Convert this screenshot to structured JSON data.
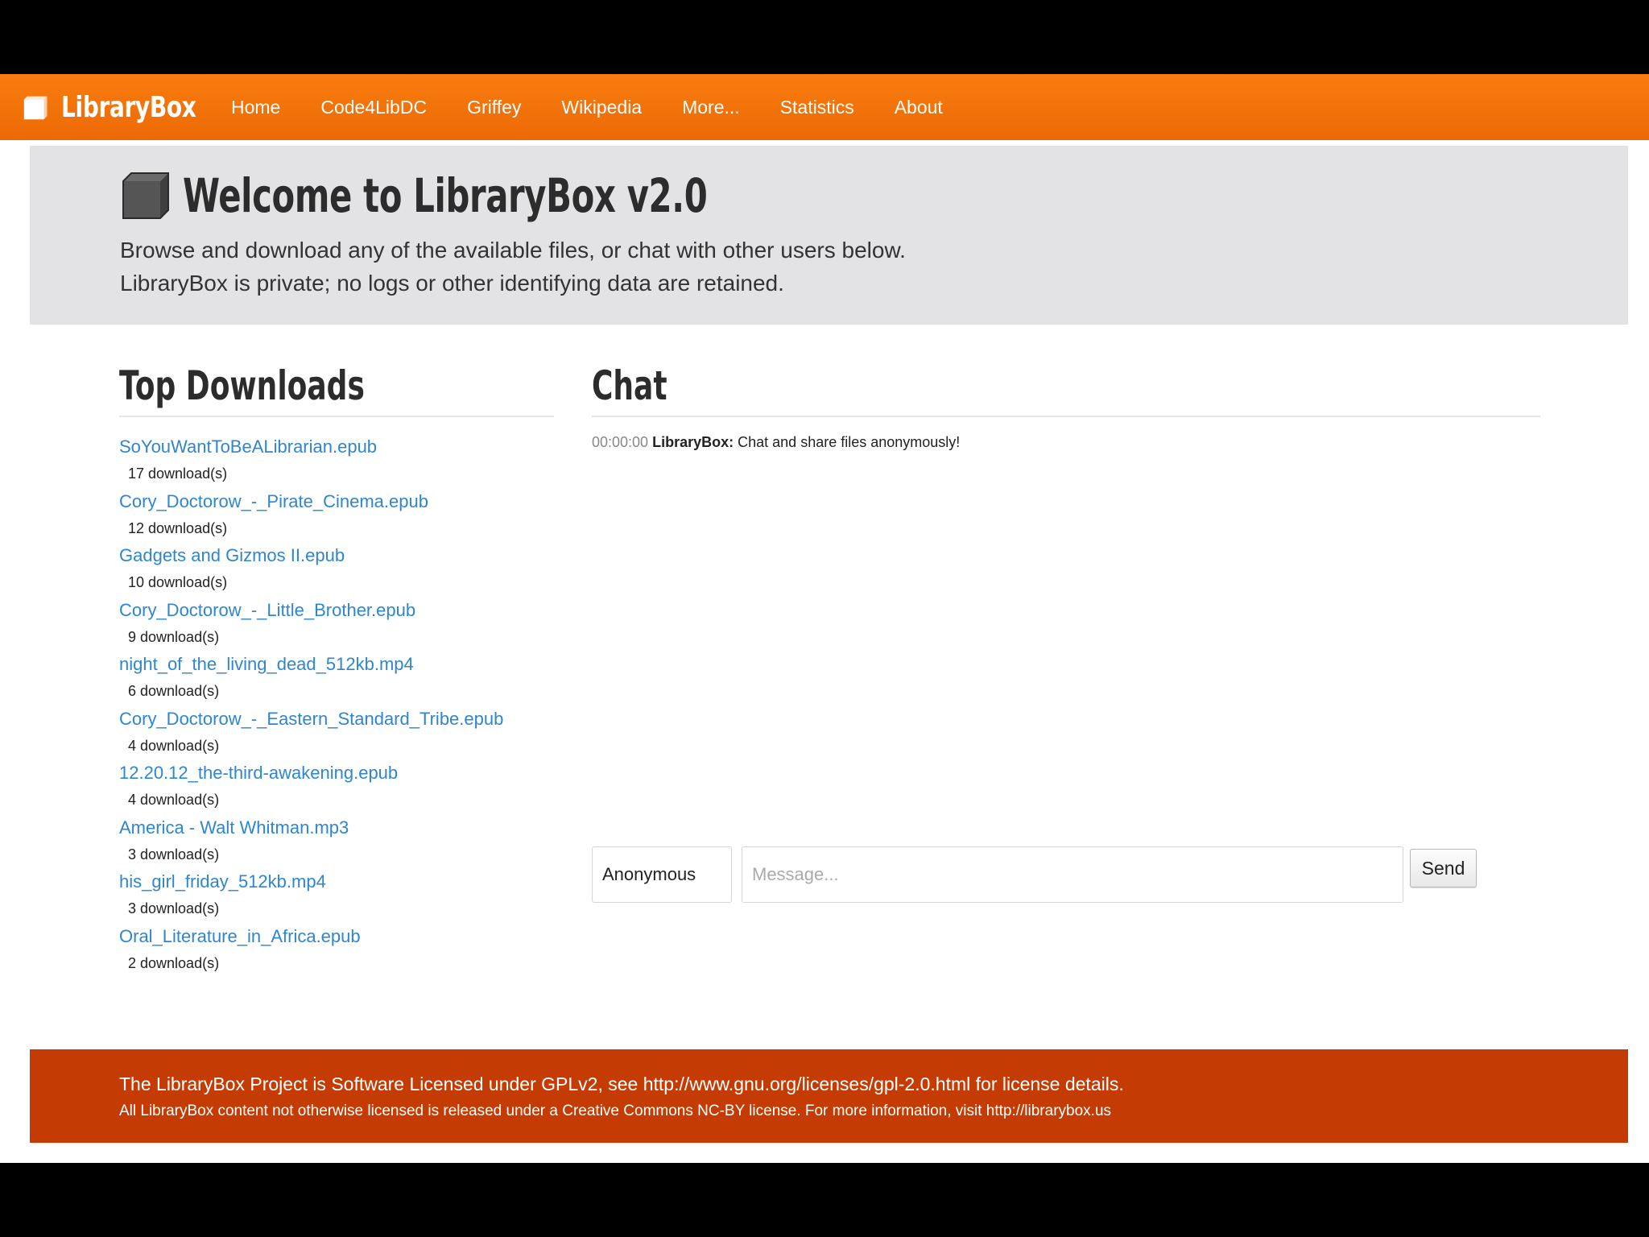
{
  "nav": {
    "brand": "LibraryBox",
    "items": [
      {
        "label": "Home"
      },
      {
        "label": "Code4LibDC"
      },
      {
        "label": "Griffey"
      },
      {
        "label": "Wikipedia"
      },
      {
        "label": "More..."
      },
      {
        "label": "Statistics"
      },
      {
        "label": "About"
      }
    ]
  },
  "hero": {
    "title": "Welcome to LibraryBox v2.0",
    "line1": "Browse and download any of the available files, or chat with other users below.",
    "line2": "LibraryBox is private; no logs or other identifying data are retained."
  },
  "downloads": {
    "heading": "Top Downloads",
    "items": [
      {
        "name": "SoYouWantToBeALibrarian.epub",
        "count": "17 download(s)"
      },
      {
        "name": "Cory_Doctorow_-_Pirate_Cinema.epub",
        "count": "12 download(s)"
      },
      {
        "name": "Gadgets and Gizmos II.epub",
        "count": "10 download(s)"
      },
      {
        "name": "Cory_Doctorow_-_Little_Brother.epub",
        "count": "9 download(s)"
      },
      {
        "name": "night_of_the_living_dead_512kb.mp4",
        "count": "6 download(s)"
      },
      {
        "name": "Cory_Doctorow_-_Eastern_Standard_Tribe.epub",
        "count": "4 download(s)"
      },
      {
        "name": "12.20.12_the-third-awakening.epub",
        "count": "4 download(s)"
      },
      {
        "name": "America - Walt Whitman.mp3",
        "count": "3 download(s)"
      },
      {
        "name": "his_girl_friday_512kb.mp4",
        "count": "3 download(s)"
      },
      {
        "name": "Oral_Literature_in_Africa.epub",
        "count": "2 download(s)"
      }
    ]
  },
  "chat": {
    "heading": "Chat",
    "messages": [
      {
        "time": "00:00:00",
        "user": "LibraryBox:",
        "text": "Chat and share files anonymously!"
      }
    ],
    "name_value": "Anonymous",
    "message_placeholder": "Message...",
    "send_label": "Send"
  },
  "footer": {
    "line1": "The LibraryBox Project is Software Licensed under GPLv2, see http://www.gnu.org/licenses/gpl-2.0.html for license details.",
    "line2": "All LibraryBox content not otherwise licensed is released under a Creative Commons NC-BY license. For more information, visit http://librarybox.us"
  },
  "colors": {
    "navbar": "#f27207",
    "link": "#2f86d0",
    "hero_bg": "#e3e3e5",
    "footer_bg": "#c43c03"
  },
  "icons": {
    "brand": "cube-icon",
    "hero": "cube-icon"
  }
}
